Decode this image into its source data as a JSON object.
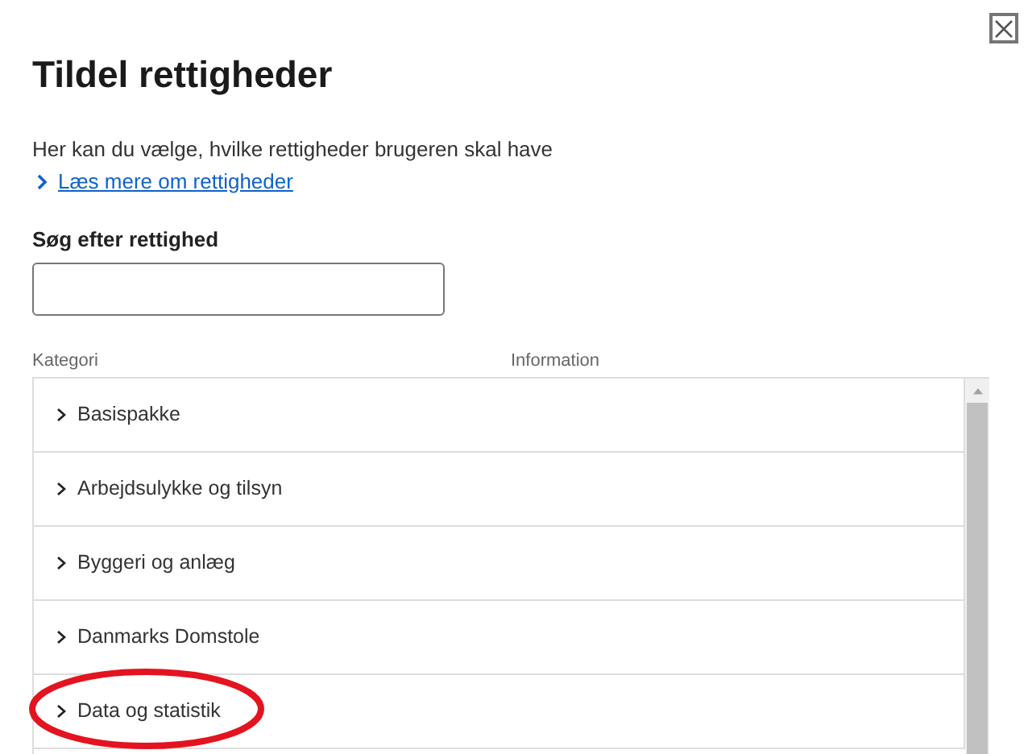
{
  "dialog": {
    "title": "Tildel rettigheder",
    "description": "Her kan du vælge, hvilke rettigheder brugeren skal have",
    "link": "Læs mere om rettigheder"
  },
  "search": {
    "label": "Søg efter rettighed"
  },
  "table": {
    "columns": [
      "Kategori",
      "Information"
    ],
    "rows": [
      {
        "label": "Basispakke",
        "expanded": false
      },
      {
        "label": "Arbejdsulykke og tilsyn",
        "expanded": false
      },
      {
        "label": "Byggeri og anlæg",
        "expanded": false
      },
      {
        "label": "Danmarks Domstole",
        "expanded": false
      },
      {
        "label": "Data og statistik",
        "expanded": false
      }
    ]
  }
}
